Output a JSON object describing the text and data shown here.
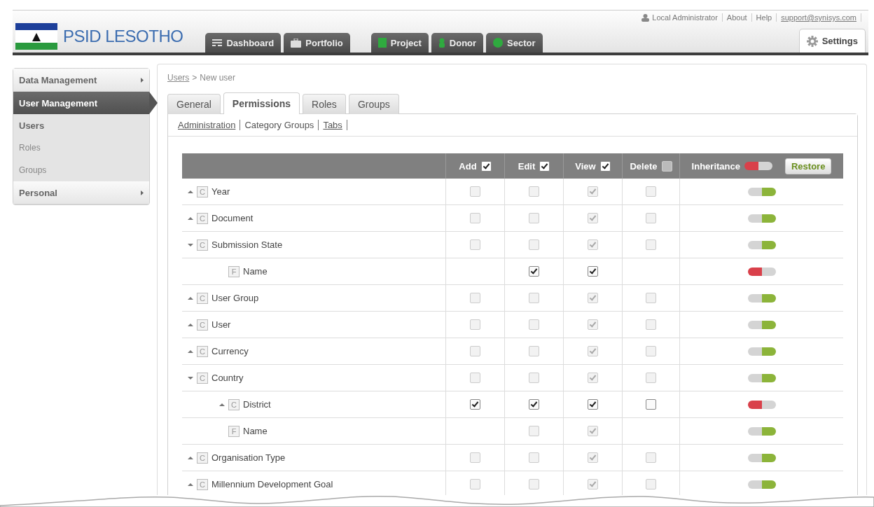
{
  "brand": {
    "title": "PSID LESOTHO"
  },
  "nav_tabs": [
    {
      "label": "Dashboard",
      "selected": false
    },
    {
      "label": "Portfolio",
      "selected": false
    },
    {
      "label": "Project",
      "selected": false
    },
    {
      "label": "Donor",
      "selected": false
    },
    {
      "label": "Sector",
      "selected": false
    },
    {
      "label": "Settings",
      "selected": true
    }
  ],
  "user_links": [
    {
      "label": "Local Administrator",
      "kind": "user"
    },
    {
      "label": "About",
      "kind": "plain"
    },
    {
      "label": "Help",
      "kind": "plain"
    },
    {
      "label": "support@synisys.com",
      "kind": "link"
    }
  ],
  "sidebar": {
    "items": [
      {
        "label": "Data Management",
        "kind": "section",
        "selected": false
      },
      {
        "label": "User Management",
        "kind": "section",
        "selected": true
      },
      {
        "label": "Users",
        "kind": "item",
        "selected": true
      },
      {
        "label": "Roles",
        "kind": "item",
        "selected": false
      },
      {
        "label": "Groups",
        "kind": "item",
        "selected": false
      },
      {
        "label": "Personal",
        "kind": "section",
        "selected": false
      }
    ]
  },
  "breadcrumb": {
    "link": "Users",
    "separator": ">",
    "current": "New user"
  },
  "tabs": [
    {
      "label": "General",
      "selected": false
    },
    {
      "label": "Permissions",
      "selected": true
    },
    {
      "label": "Roles",
      "selected": false
    },
    {
      "label": "Groups",
      "selected": false
    }
  ],
  "subtabs": [
    {
      "label": "Administration",
      "selected": false
    },
    {
      "label": "Category Groups",
      "selected": true
    },
    {
      "label": "Tabs",
      "selected": false
    }
  ],
  "table": {
    "columns": [
      {
        "label": "Add",
        "checked": true,
        "disabled": false
      },
      {
        "label": "Edit",
        "checked": true,
        "disabled": false
      },
      {
        "label": "View",
        "checked": true,
        "disabled": false
      },
      {
        "label": "Delete",
        "checked": false,
        "disabled": true
      }
    ],
    "inheritance": {
      "label": "Inheritance",
      "on": false,
      "button": "Restore"
    },
    "rows": [
      {
        "name": "Year",
        "kind": "category",
        "badge": "C",
        "expanded": false,
        "add": {
          "checked": false,
          "disabled": true
        },
        "edit": {
          "checked": false,
          "disabled": true
        },
        "view": {
          "checked": true,
          "disabled": true
        },
        "delete": {
          "checked": false,
          "disabled": true
        },
        "inherit": true
      },
      {
        "name": "Document",
        "kind": "category",
        "badge": "C",
        "expanded": false,
        "add": {
          "checked": false,
          "disabled": true
        },
        "edit": {
          "checked": false,
          "disabled": true
        },
        "view": {
          "checked": true,
          "disabled": true
        },
        "delete": {
          "checked": false,
          "disabled": true
        },
        "inherit": true
      },
      {
        "name": "Submission State",
        "kind": "category",
        "badge": "C",
        "expanded": true,
        "add": {
          "checked": false,
          "disabled": true
        },
        "edit": {
          "checked": false,
          "disabled": true
        },
        "view": {
          "checked": true,
          "disabled": true
        },
        "delete": {
          "checked": false,
          "disabled": true
        },
        "inherit": true,
        "children": [
          {
            "name": "Name",
            "kind": "field",
            "badge": "F",
            "edit": {
              "checked": true,
              "disabled": false
            },
            "view": {
              "checked": true,
              "disabled": false
            },
            "inherit": false
          }
        ]
      },
      {
        "name": "User Group",
        "kind": "category",
        "badge": "C",
        "expanded": false,
        "add": {
          "checked": false,
          "disabled": true
        },
        "edit": {
          "checked": false,
          "disabled": true
        },
        "view": {
          "checked": true,
          "disabled": true
        },
        "delete": {
          "checked": false,
          "disabled": true
        },
        "inherit": true
      },
      {
        "name": "User",
        "kind": "category",
        "badge": "C",
        "expanded": false,
        "add": {
          "checked": false,
          "disabled": true
        },
        "edit": {
          "checked": false,
          "disabled": true
        },
        "view": {
          "checked": true,
          "disabled": true
        },
        "delete": {
          "checked": false,
          "disabled": true
        },
        "inherit": true
      },
      {
        "name": "Currency",
        "kind": "category",
        "badge": "C",
        "expanded": false,
        "add": {
          "checked": false,
          "disabled": true
        },
        "edit": {
          "checked": false,
          "disabled": true
        },
        "view": {
          "checked": true,
          "disabled": true
        },
        "delete": {
          "checked": false,
          "disabled": true
        },
        "inherit": true
      },
      {
        "name": "Country",
        "kind": "category",
        "badge": "C",
        "expanded": true,
        "add": {
          "checked": false,
          "disabled": true
        },
        "edit": {
          "checked": false,
          "disabled": true
        },
        "view": {
          "checked": true,
          "disabled": true
        },
        "delete": {
          "checked": false,
          "disabled": true
        },
        "inherit": true,
        "children": [
          {
            "name": "District",
            "kind": "category",
            "badge": "C",
            "expanded": false,
            "add": {
              "checked": true,
              "disabled": false
            },
            "edit": {
              "checked": true,
              "disabled": false
            },
            "view": {
              "checked": true,
              "disabled": false
            },
            "delete": {
              "checked": false,
              "disabled": false
            },
            "inherit": false
          },
          {
            "name": "Name",
            "kind": "field",
            "badge": "F",
            "edit": {
              "checked": false,
              "disabled": true
            },
            "view": {
              "checked": true,
              "disabled": true
            },
            "inherit": true
          }
        ]
      },
      {
        "name": "Organisation Type",
        "kind": "category",
        "badge": "C",
        "expanded": false,
        "add": {
          "checked": false,
          "disabled": true
        },
        "edit": {
          "checked": false,
          "disabled": true
        },
        "view": {
          "checked": true,
          "disabled": true
        },
        "delete": {
          "checked": false,
          "disabled": true
        },
        "inherit": true
      },
      {
        "name": "Millennium Development Goal",
        "kind": "category",
        "badge": "C",
        "expanded": false,
        "add": {
          "checked": false,
          "disabled": true
        },
        "edit": {
          "checked": false,
          "disabled": true
        },
        "view": {
          "checked": true,
          "disabled": true
        },
        "delete": {
          "checked": false,
          "disabled": true
        },
        "inherit": true
      }
    ]
  }
}
